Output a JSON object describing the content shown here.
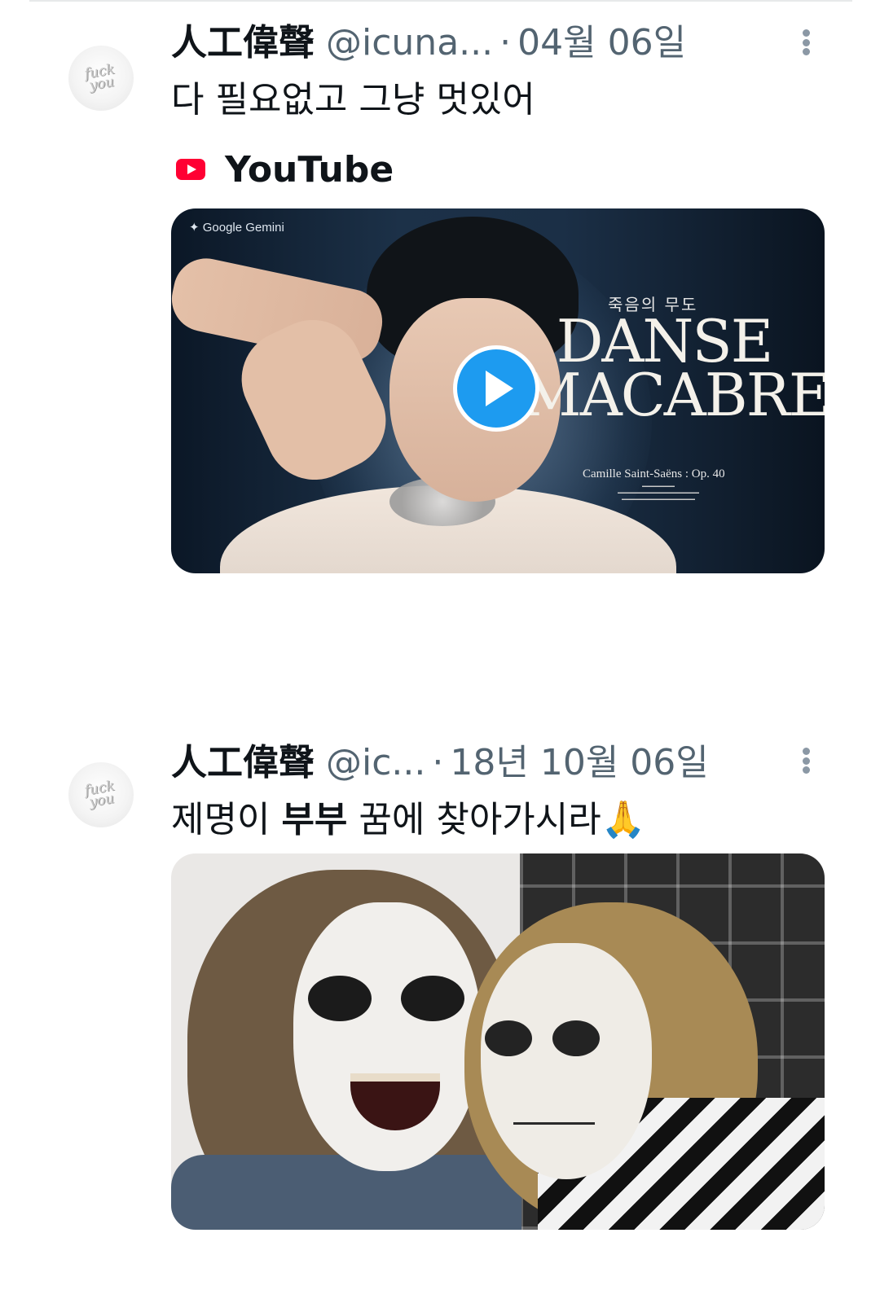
{
  "tweets": [
    {
      "display_name": "人工偉聲",
      "handle": "@icuna...",
      "separator": "·",
      "date": "04월 06일",
      "text": "다 필요없고 그냥 멋있어",
      "link_card": {
        "source": "YouTube",
        "badge": "✦ Google Gemini",
        "korean_title": "죽음의 무도",
        "title_line1": "DANSE",
        "title_line2": "MACABRE",
        "composer": "Camille Saint-Saëns : Op. 40"
      }
    },
    {
      "display_name": "人工偉聲",
      "handle": "@ic...",
      "separator": "·",
      "date": "18년 10월 06일",
      "text_before": "제명이 ",
      "text_bold": "부부",
      "text_after": " 꿈에 찾아가시라",
      "emoji": "🙏"
    }
  ],
  "avatar_text": "fuck you",
  "colors": {
    "accent": "#1d9bf0",
    "secondary_text": "#536471",
    "youtube_red": "#ff0033"
  },
  "icons": [
    "more-icon",
    "youtube-icon",
    "play-icon"
  ]
}
